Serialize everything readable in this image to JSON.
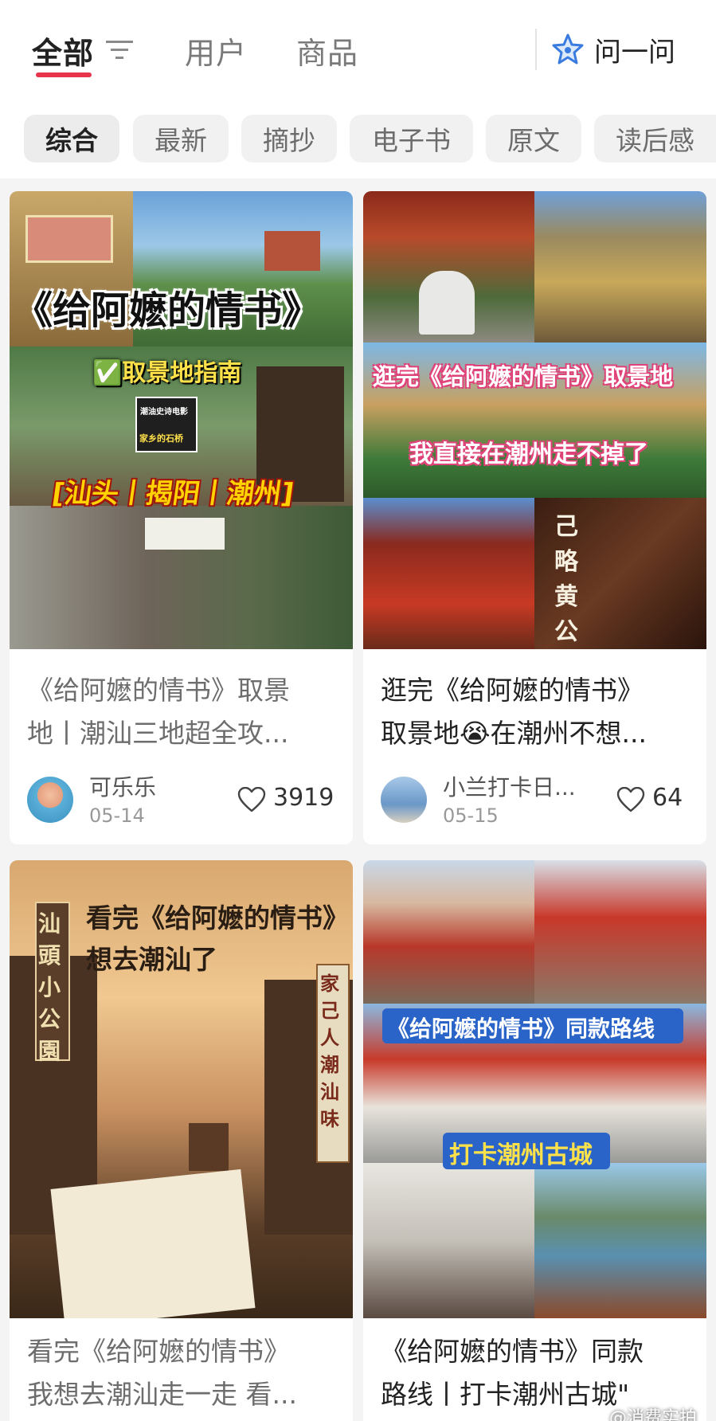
{
  "nav": {
    "tabs": [
      "全部",
      "用户",
      "商品"
    ],
    "ask_label": "问一问"
  },
  "chips": [
    "综合",
    "最新",
    "摘抄",
    "电子书",
    "原文",
    "读后感"
  ],
  "cards": [
    {
      "title_lines": [
        "《给阿嬷的情书》取景",
        "地丨潮汕三地超全攻..."
      ],
      "author": "可乐乐",
      "date": "05-14",
      "likes": "3919",
      "overlay": {
        "main": "《给阿嬷的情书》",
        "sub": "✅取景地指南",
        "places": "[汕头丨揭阳丨潮州]",
        "sign1": "家乡的石桥",
        "sign2": "潮油史诗电影"
      }
    },
    {
      "title_lines": [
        "逛完《给阿嬷的情书》",
        "取景地😭在潮州不想..."
      ],
      "author": "小兰打卡日...",
      "date": "05-15",
      "likes": "64",
      "overlay": {
        "line1": "逛完《给阿嬷的情书》取景地",
        "line2": "我直接在潮州走不掉了",
        "plaque": "己略黄公祠"
      }
    },
    {
      "title_lines": [
        "看完《给阿嬷的情书》",
        "我想去潮汕走一走 看..."
      ],
      "overlay": {
        "line1": "看完《给阿嬷的情书》",
        "line2": "想去潮汕了",
        "left_sign": "汕頭小公園",
        "right_sign": "家己人潮汕味"
      }
    },
    {
      "title_lines": [
        "《给阿嬷的情书》同款",
        "路线丨打卡潮州古城\""
      ],
      "overlay": {
        "line1": "《给阿嬷的情书》同款路线",
        "line2": "打卡潮州古城"
      }
    }
  ],
  "watermark": "@消费实拍",
  "colors": {
    "accent": "#e8344a",
    "ask_icon": "#3a7be0"
  }
}
